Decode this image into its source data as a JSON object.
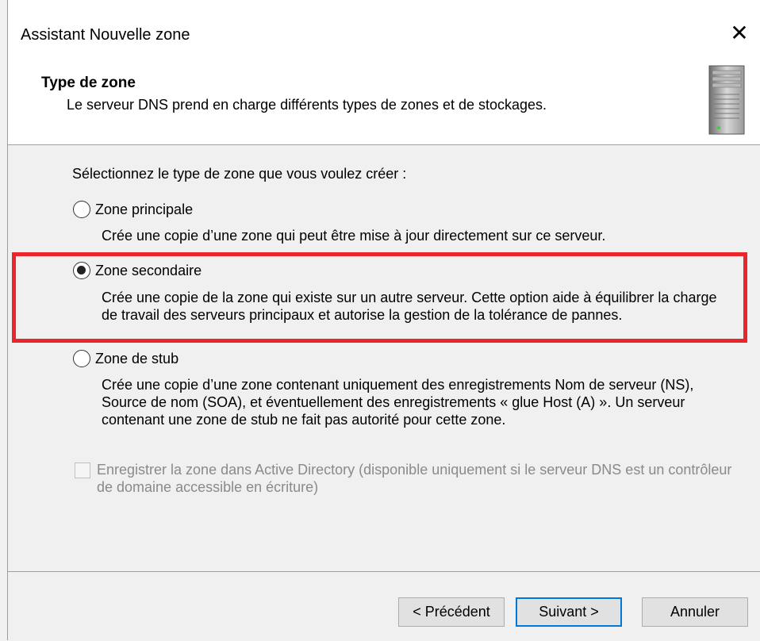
{
  "window": {
    "title": "Assistant Nouvelle zone",
    "close_label": "✕"
  },
  "header": {
    "title": "Type de zone",
    "subtitle": "Le serveur DNS prend en charge différents types de zones et de stockages.",
    "icon": "server-icon"
  },
  "prompt": "Sélectionnez le type de zone que vous voulez créer :",
  "options": [
    {
      "label": "Zone principale",
      "description": "Crée une copie d’une zone qui peut être mise à jour directement sur ce serveur.",
      "selected": false
    },
    {
      "label": "Zone secondaire",
      "description": "Crée une copie de la zone qui existe sur un autre serveur. Cette option aide à équilibrer la charge de travail des serveurs principaux et autorise la gestion de la tolérance de pannes.",
      "selected": true
    },
    {
      "label": "Zone de stub",
      "description": "Crée une copie d’une zone contenant uniquement des enregistrements Nom de serveur (NS), Source de nom (SOA), et éventuellement des enregistrements « glue Host (A) ». Un serveur contenant une zone de stub ne fait pas autorité pour cette zone.",
      "selected": false
    }
  ],
  "ad_checkbox": {
    "label": "Enregistrer la zone dans Active Directory (disponible uniquement si le serveur DNS est un contrôleur de domaine accessible en écriture)",
    "checked": false,
    "disabled": true
  },
  "buttons": {
    "back": "< Précédent",
    "next": "Suivant >",
    "cancel": "Annuler"
  },
  "colors": {
    "highlight": "#e8262b",
    "primary_button_border": "#0078d7"
  }
}
